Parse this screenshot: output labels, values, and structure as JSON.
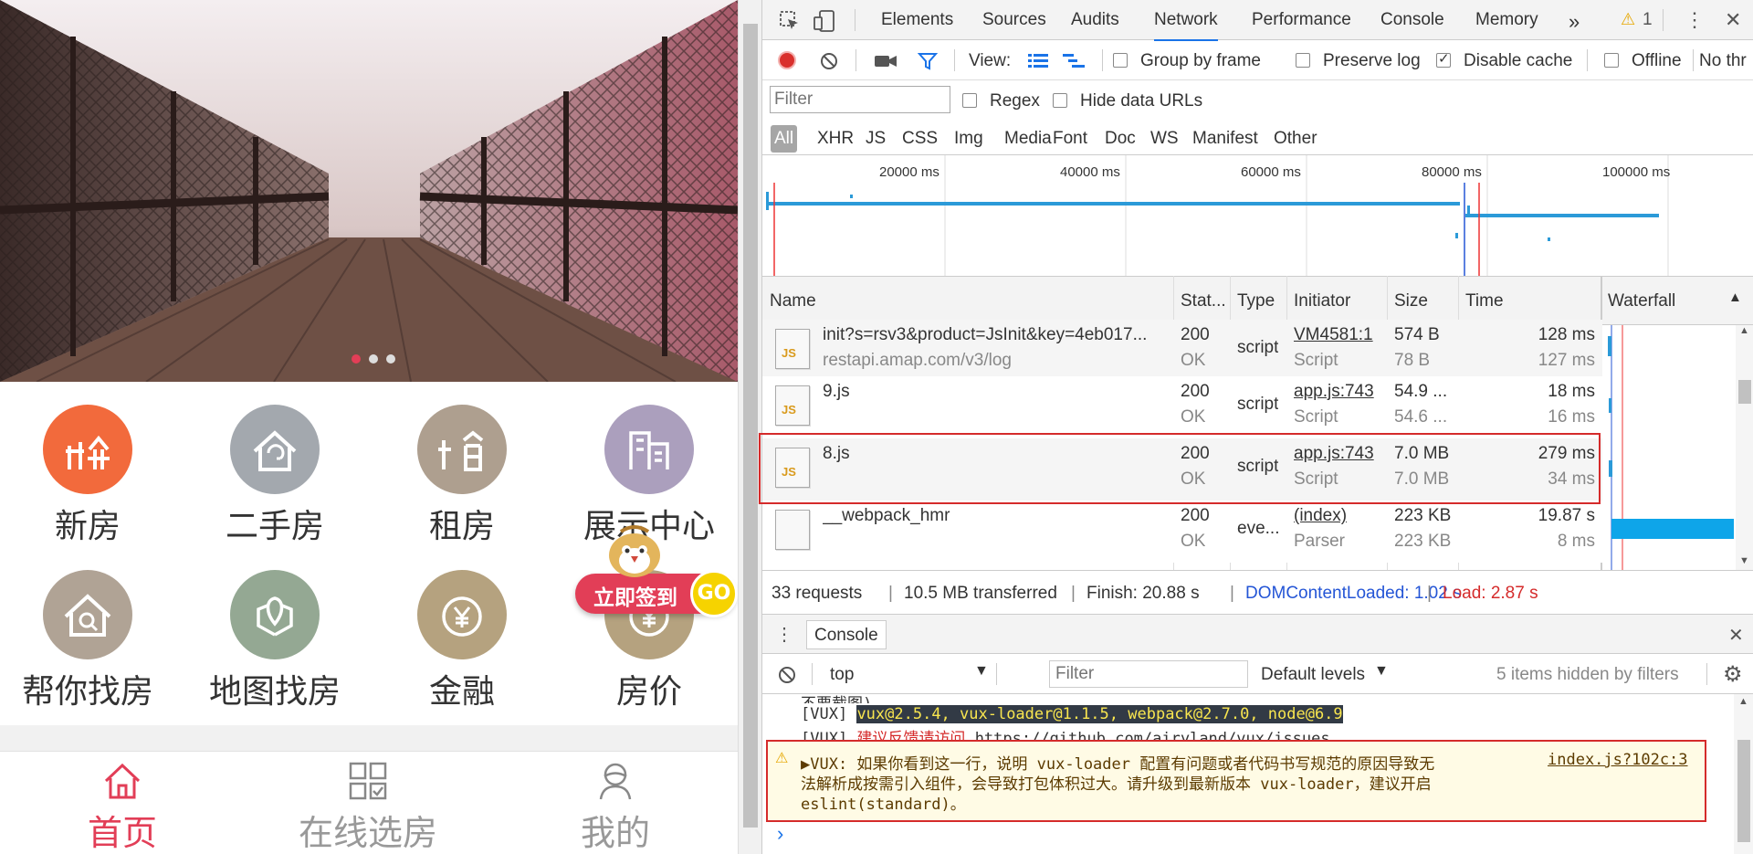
{
  "mobile": {
    "categories": [
      {
        "label": "新房",
        "icon": "new-house-icon",
        "color": "#f26a3c"
      },
      {
        "label": "二手房",
        "icon": "second-hand-house-icon",
        "color": "#a3a8ae"
      },
      {
        "label": "租房",
        "icon": "rent-house-icon",
        "color": "#ae9f8f"
      },
      {
        "label": "展示中心",
        "icon": "exhibition-center-icon",
        "color": "#ab9fbd"
      },
      {
        "label": "帮你找房",
        "icon": "find-house-icon",
        "color": "#b0a395"
      },
      {
        "label": "地图找房",
        "icon": "map-find-house-icon",
        "color": "#94a893"
      },
      {
        "label": "金融",
        "icon": "finance-icon",
        "color": "#b5a27f"
      },
      {
        "label": "房价",
        "icon": "house-price-icon",
        "color": "#b5a27f"
      }
    ],
    "signin": {
      "label": "立即签到",
      "go": "GO"
    },
    "tabs": [
      {
        "label": "首页",
        "icon": "home-icon",
        "active": true
      },
      {
        "label": "在线选房",
        "icon": "grid-select-icon",
        "active": false
      },
      {
        "label": "我的",
        "icon": "user-icon",
        "active": false
      }
    ],
    "active_color": "#e23e57"
  },
  "devtools": {
    "tabs": [
      "Elements",
      "Sources",
      "Audits",
      "Network",
      "Performance",
      "Console",
      "Memory"
    ],
    "active_tab": "Network",
    "more": "»",
    "warning_count": "1",
    "toolbar": {
      "view_label": "View:",
      "group_by_frame": "Group by frame",
      "preserve_log": "Preserve log",
      "disable_cache": "Disable cache",
      "offline": "Offline",
      "throttle": "No thr"
    },
    "filter": {
      "placeholder": "Filter",
      "regex": "Regex",
      "hide_data_urls": "Hide data URLs",
      "types": [
        "All",
        "XHR",
        "JS",
        "CSS",
        "Img",
        "Media",
        "Font",
        "Doc",
        "WS",
        "Manifest",
        "Other"
      ]
    },
    "timeline_ticks": [
      "20000 ms",
      "40000 ms",
      "60000 ms",
      "80000 ms",
      "100000 ms"
    ],
    "columns": {
      "name": "Name",
      "status": "Stat...",
      "type": "Type",
      "initiator": "Initiator",
      "size": "Size",
      "time": "Time",
      "waterfall": "Waterfall"
    },
    "requests": [
      {
        "name": "init?s=rsv3&product=JsInit&key=4eb017...",
        "sub": "restapi.amap.com/v3/log",
        "status": "200",
        "status_text": "OK",
        "type": "script",
        "initiator": "VM4581:1",
        "initiator_type": "Script",
        "size": "574 B",
        "size2": "78 B",
        "time": "128 ms",
        "time2": "127 ms",
        "icon": "js-file-icon"
      },
      {
        "name": "9.js",
        "sub": "",
        "status": "200",
        "status_text": "OK",
        "type": "script",
        "initiator": "app.js:743",
        "initiator_type": "Script",
        "size": "54.9 ...",
        "size2": "54.6 ...",
        "time": "18 ms",
        "time2": "16 ms",
        "icon": "js-file-icon"
      },
      {
        "name": "8.js",
        "sub": "",
        "status": "200",
        "status_text": "OK",
        "type": "script",
        "initiator": "app.js:743",
        "initiator_type": "Script",
        "size": "7.0 MB",
        "size2": "7.0 MB",
        "time": "279 ms",
        "time2": "34 ms",
        "icon": "js-file-icon",
        "highlighted": true
      },
      {
        "name": "__webpack_hmr",
        "sub": "",
        "status": "200",
        "status_text": "OK",
        "type": "eve...",
        "initiator": "(index)",
        "initiator_type": "Parser",
        "size": "223 KB",
        "size2": "223 KB",
        "time": "19.87 s",
        "time2": "8 ms",
        "icon": "blank-file-icon"
      }
    ],
    "summary": {
      "requests": "33 requests",
      "transferred": "10.5 MB transferred",
      "finish": "Finish: 20.88 s",
      "dcl": "DOMContentLoaded: 1.02 s",
      "load": "Load: 2.87 s"
    },
    "console": {
      "tab": "Console",
      "context": "top",
      "filter_placeholder": "Filter",
      "levels": "Default levels",
      "hidden": "5 items hidden by filters",
      "line0": "不要截图)。",
      "line1_prefix": "[VUX]",
      "line1_highlight": "vux@2.5.4, vux-loader@1.1.5, webpack@2.7.0, node@6.9",
      "line2_prefix": "[VUX]",
      "line2_text": "建议反馈请访问",
      "line2_link": "https://github.com/airyland/vux/issues",
      "warn_line1": "▶VUX: 如果你看到这一行，说明 vux-loader 配置有问题或者代码书写规范的原因导致无",
      "warn_source": "index.js?102c:3",
      "warn_line2": "法解析成按需引入组件，会导致打包体积过大。请升级到最新版本 vux-loader，建议开启",
      "warn_line3": "eslint(standard)。",
      "prompt": "›"
    }
  }
}
